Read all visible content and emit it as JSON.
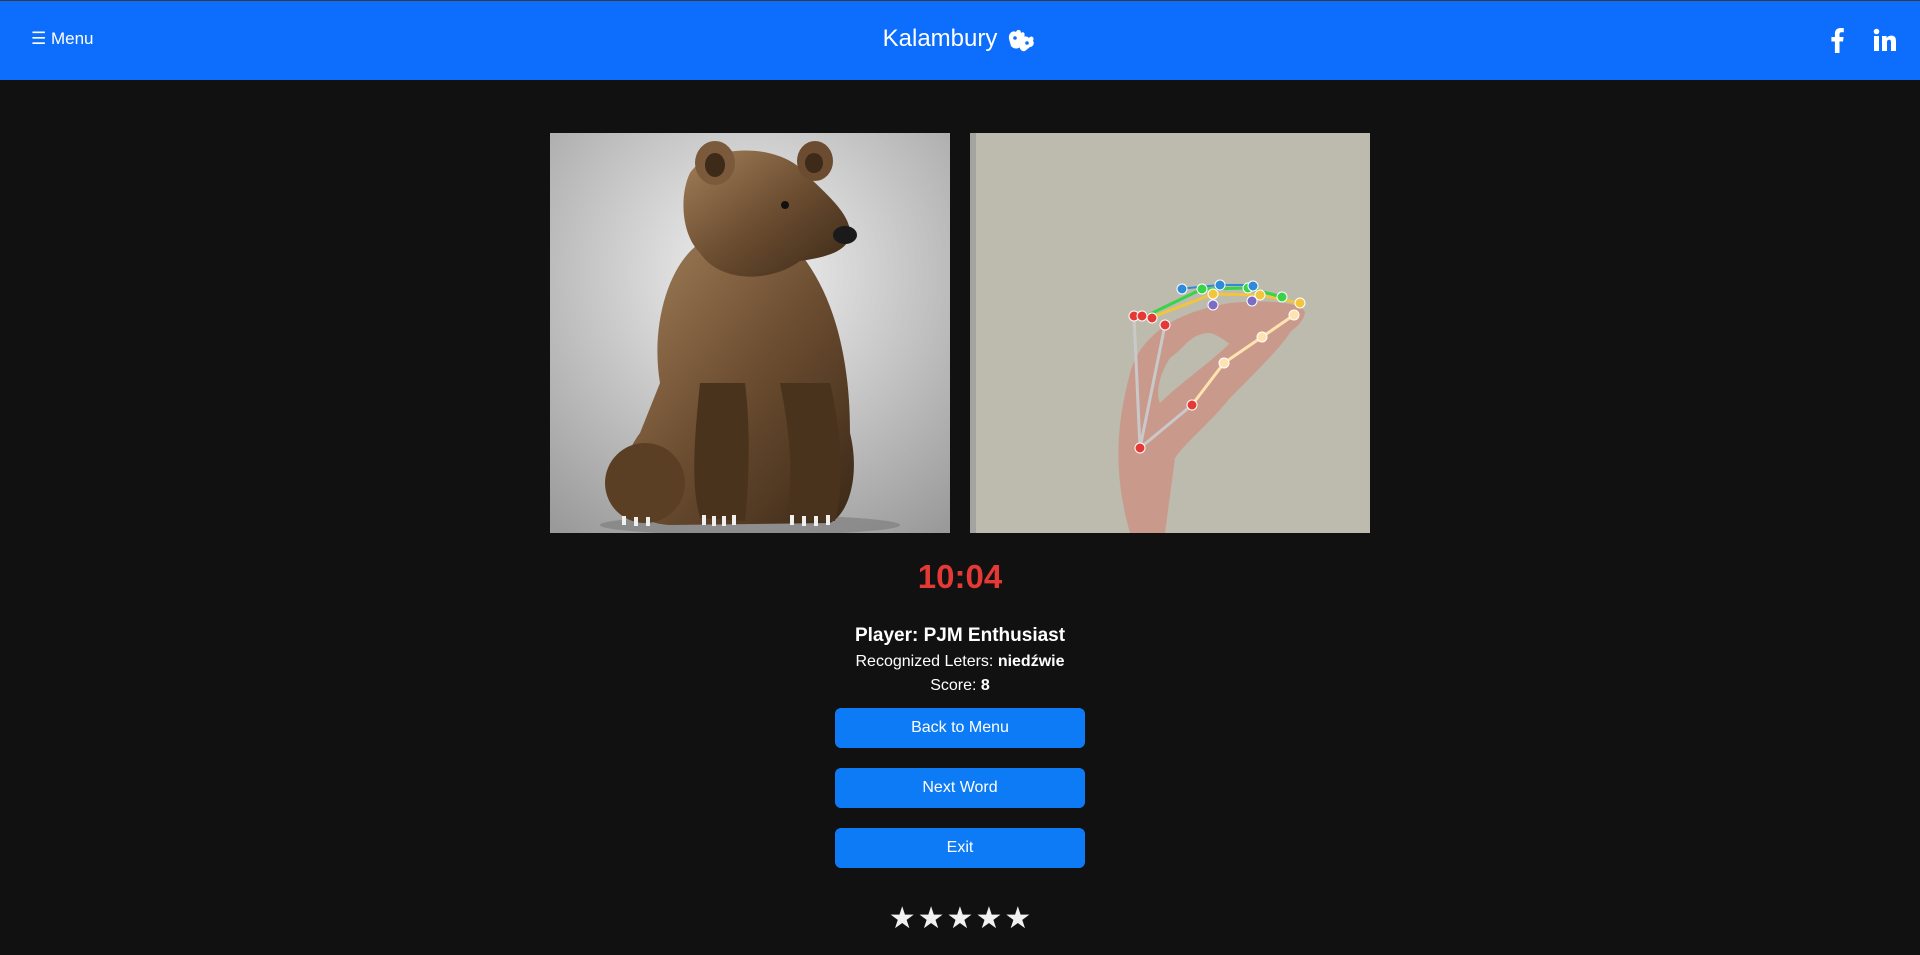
{
  "header": {
    "menu_label": "☰ Menu",
    "brand_title": "Kalambury",
    "brand_icon": "sign-language-hands-icon",
    "social": [
      {
        "name": "facebook",
        "icon": "facebook-icon"
      },
      {
        "name": "linkedin",
        "icon": "linkedin-icon"
      }
    ],
    "colors": {
      "bar": "#0d6efd"
    }
  },
  "game": {
    "target_image": "bear-picture",
    "camera_image": "webcam-hand-landmarks",
    "timer": "10:04",
    "player_line": "Player: PJM Enthusiast",
    "recognized_label": "Recognized Leters:",
    "recognized_value": "niedźwie",
    "score_label": "Score:",
    "score_value": "8"
  },
  "actions": {
    "back_to_menu": "Back to Menu",
    "next_word": "Next Word",
    "exit": "Exit"
  },
  "rating": {
    "stars": [
      "★",
      "★",
      "★",
      "★",
      "★"
    ]
  },
  "colors": {
    "background": "#111111",
    "accent": "#0d7bf5",
    "timer": "#e53935"
  }
}
